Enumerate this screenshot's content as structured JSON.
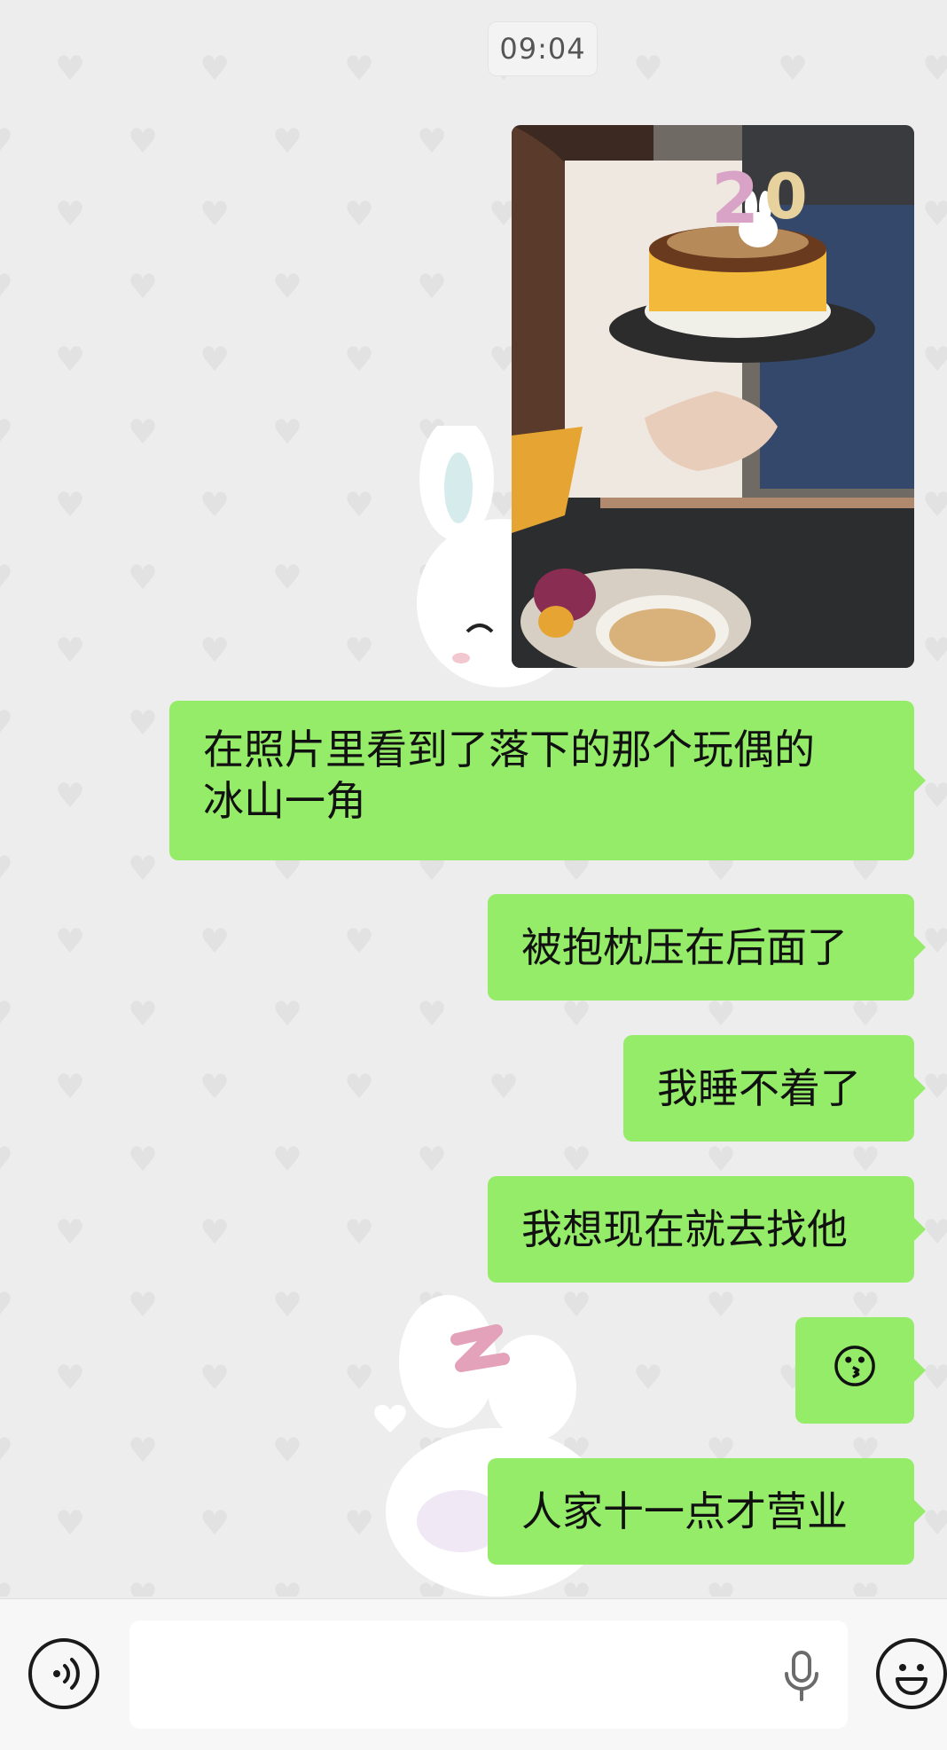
{
  "chat": {
    "timestamp": "09:04",
    "photo_alt": "photo",
    "messages": [
      {
        "text": "在照片里看到了落下的那个玩偶的冰山一角",
        "line1": "在照片里看到了落下的那个玩偶的",
        "line2": "冰山一角"
      },
      {
        "text": "被抱枕压在后面了"
      },
      {
        "text": "我睡不着了"
      },
      {
        "text": "我想现在就去找他"
      },
      {
        "text": "😗",
        "kind": "emoji"
      },
      {
        "text": "人家十一点才营业"
      }
    ]
  },
  "input": {
    "value": "",
    "voice_icon": "voice-icon",
    "mic_icon": "microphone-icon",
    "emoji_icon": "smiley-icon"
  },
  "colors": {
    "bubble": "#95ec69",
    "background": "#ededed",
    "wallpaper_heart": "#e2e2e2"
  }
}
